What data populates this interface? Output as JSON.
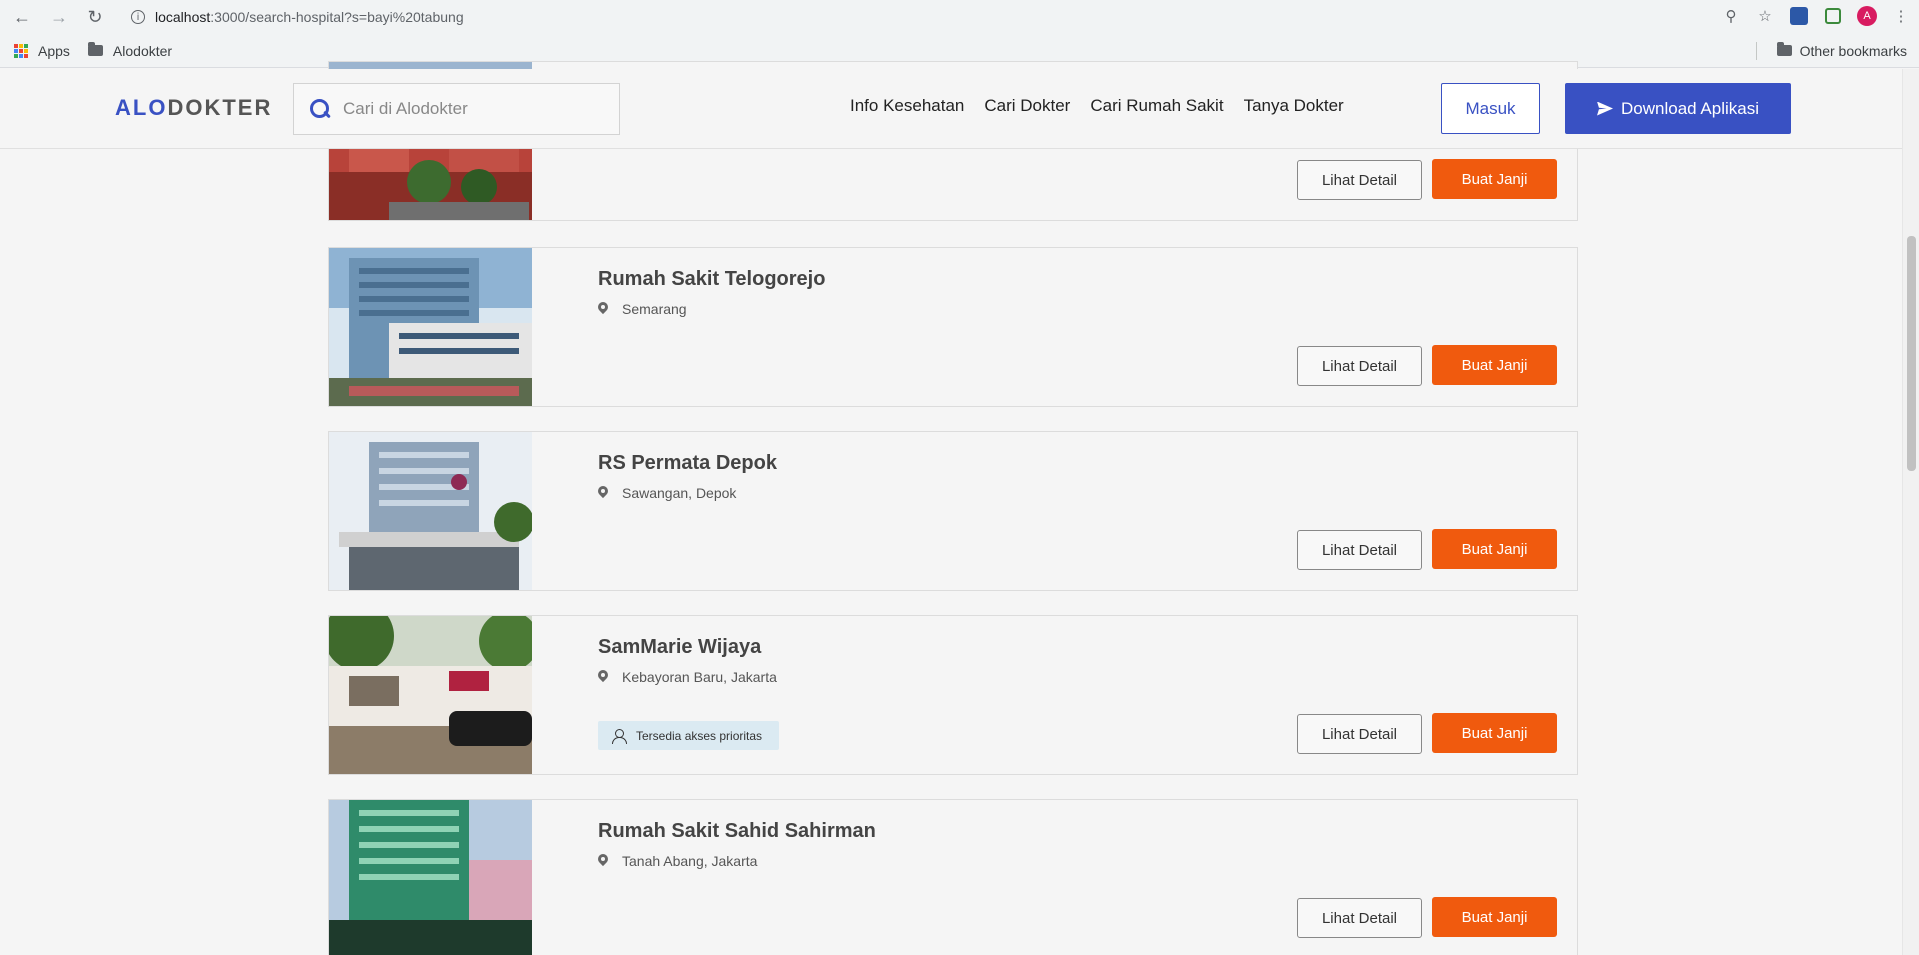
{
  "browser": {
    "url_host": "localhost",
    "url_rest": ":3000/search-hospital?s=bayi%20tabung",
    "bookmarks": [
      "Apps",
      "Alodokter"
    ],
    "other_bookmarks": "Other bookmarks",
    "avatar_letter": "A"
  },
  "header": {
    "logo_alo": "ALO",
    "logo_dokter": "DOKTER",
    "search_placeholder": "Cari di Alodokter",
    "nav": [
      "Info Kesehatan",
      "Cari Dokter",
      "Cari Rumah Sakit",
      "Tanya Dokter"
    ],
    "login_label": "Masuk",
    "download_label": "Download Aplikasi"
  },
  "buttons": {
    "detail_label": "Lihat Detail",
    "book_label": "Buat Janji"
  },
  "hospitals": [
    {
      "name": "",
      "location": ""
    },
    {
      "name": "Rumah Sakit Telogorejo",
      "location": "Semarang"
    },
    {
      "name": "RS Permata Depok",
      "location": "Sawangan, Depok"
    },
    {
      "name": "SamMarie Wijaya",
      "location": "Kebayoran Baru, Jakarta",
      "badge": "Tersedia akses prioritas"
    },
    {
      "name": "Rumah Sakit Sahid Sahirman",
      "location": "Tanah Abang, Jakarta"
    }
  ],
  "colors": {
    "brand_blue": "#3951c3",
    "book_orange": "#f05a0e",
    "badge_bg": "#dbeaf2"
  }
}
